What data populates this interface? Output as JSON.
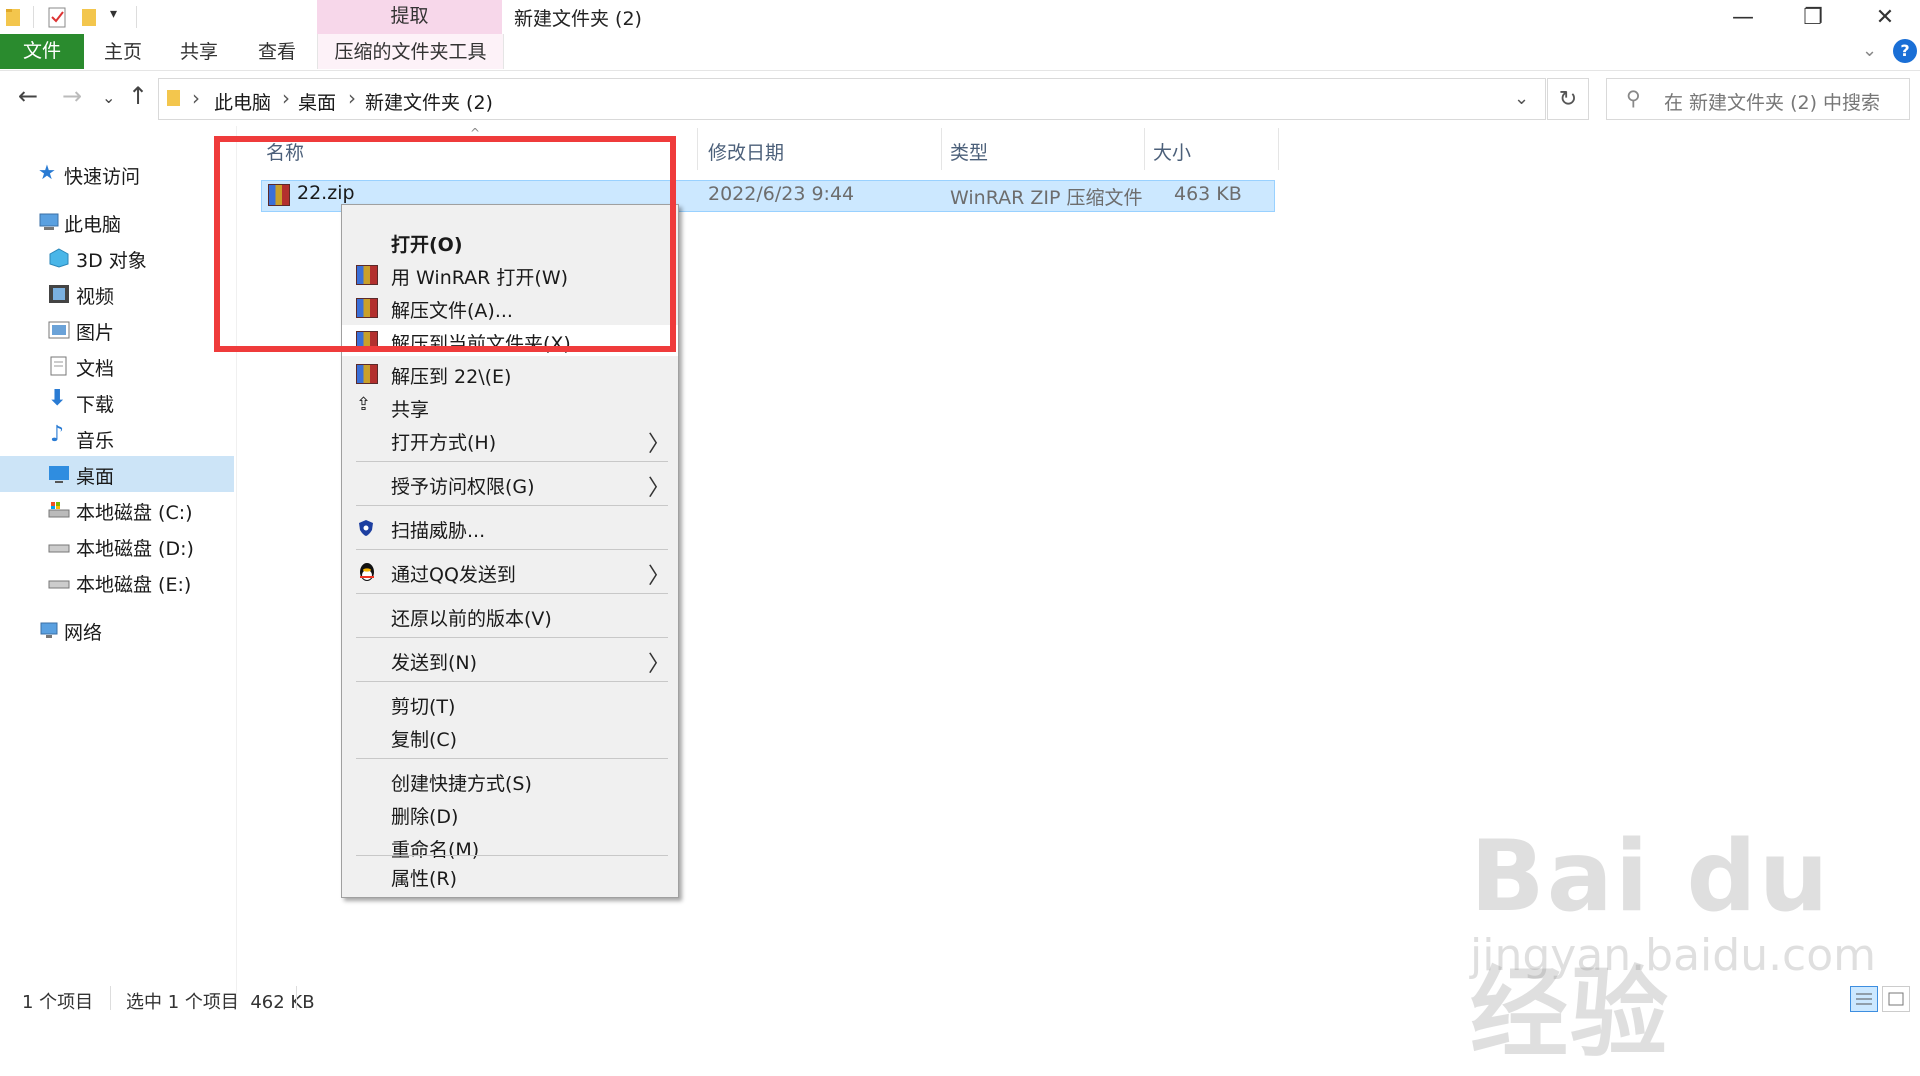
{
  "window": {
    "title": "新建文件夹 (2)",
    "context_tab_top": "提取",
    "minimize": "—",
    "maximize": "❐",
    "close": "✕"
  },
  "ribbon": {
    "file": "文件",
    "home": "主页",
    "share": "共享",
    "view": "查看",
    "context_tool": "压缩的文件夹工具",
    "collapse": "⌄",
    "help": "?"
  },
  "nav": {
    "back": "←",
    "forward": "→",
    "recent": "⌄",
    "up": "↑"
  },
  "breadcrumb": [
    "此电脑",
    "桌面",
    "新建文件夹 (2)"
  ],
  "search": {
    "placeholder": "在 新建文件夹 (2) 中搜索"
  },
  "sidebar": {
    "quick_access": "快速访问",
    "this_pc": "此电脑",
    "items": [
      "3D 对象",
      "视频",
      "图片",
      "文档",
      "下载",
      "音乐",
      "桌面",
      "本地磁盘 (C:)",
      "本地磁盘 (D:)",
      "本地磁盘 (E:)"
    ],
    "network": "网络",
    "selected": "桌面"
  },
  "columns": {
    "name": "名称",
    "date": "修改日期",
    "type": "类型",
    "size": "大小"
  },
  "files": [
    {
      "name": "22.zip",
      "date": "2022/6/23 9:44",
      "type": "WinRAR ZIP 压缩文件",
      "size": "463 KB"
    }
  ],
  "context_menu": {
    "items": [
      {
        "label": "打开(O)",
        "icon": "none",
        "bold": true
      },
      {
        "label": "用 WinRAR 打开(W)",
        "icon": "winrar-icon"
      },
      {
        "label": "解压文件(A)...",
        "icon": "winrar-icon"
      },
      {
        "label": "解压到当前文件夹(X)",
        "icon": "winrar-icon",
        "highlighted": true
      },
      {
        "label": "解压到 22\\(E)",
        "icon": "winrar-icon"
      },
      {
        "label": "共享",
        "icon": "share-icon"
      },
      {
        "label": "打开方式(H)",
        "submenu": true
      },
      {
        "label": "授予访问权限(G)",
        "submenu": true
      },
      {
        "label": "扫描威胁...",
        "icon": "defender-icon"
      },
      {
        "label": "通过QQ发送到",
        "icon": "qq-icon",
        "submenu": true
      },
      {
        "label": "还原以前的版本(V)"
      },
      {
        "label": "发送到(N)",
        "submenu": true
      },
      {
        "label": "剪切(T)"
      },
      {
        "label": "复制(C)"
      },
      {
        "label": "创建快捷方式(S)"
      },
      {
        "label": "删除(D)"
      },
      {
        "label": "重命名(M)"
      },
      {
        "label": "属性(R)"
      }
    ],
    "submenu_arrow": "〉"
  },
  "status": {
    "count": "1 个项目",
    "selected": "选中 1 个项目  462 KB"
  },
  "watermark": {
    "main": "Bai du 经验",
    "sub": "jingyan.baidu.com"
  },
  "colors": {
    "accent_green": "#2a8b2e",
    "selection": "#cce8ff",
    "highlight_box": "#ef3b3b",
    "context_tab": "#f7d7ea"
  }
}
